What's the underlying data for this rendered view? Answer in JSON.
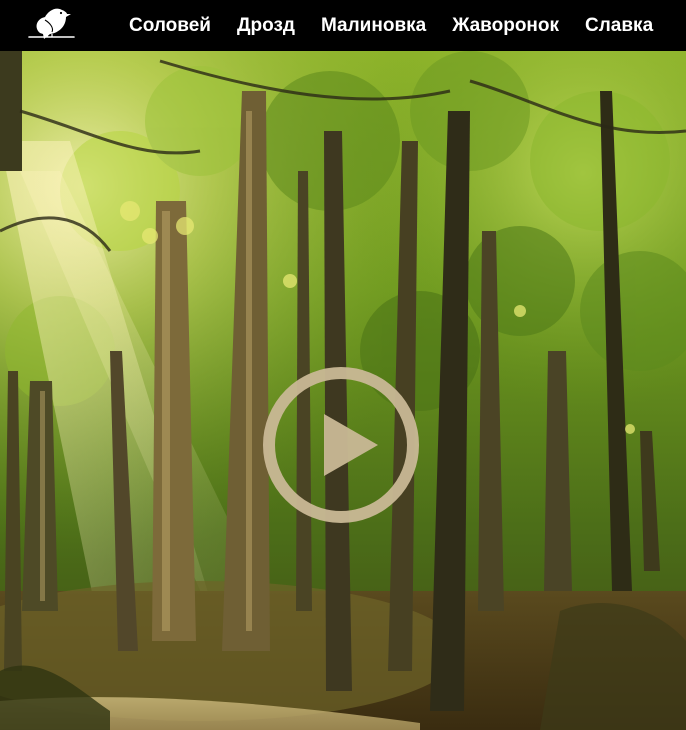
{
  "header": {
    "logo_icon": "bird-icon",
    "nav": [
      {
        "label": "Соловей"
      },
      {
        "label": "Дрозд"
      },
      {
        "label": "Малиновка"
      },
      {
        "label": "Жаворонок"
      },
      {
        "label": "Славка"
      }
    ]
  },
  "hero": {
    "background": "sunlit-forest-image",
    "play_icon": "play-icon",
    "play_color": "#c9b896"
  },
  "colors": {
    "header_bg": "#000000",
    "nav_text": "#ffffff"
  }
}
